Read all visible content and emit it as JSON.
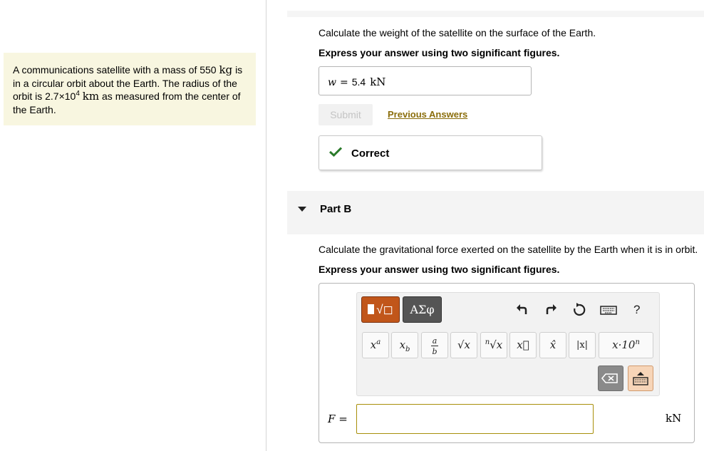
{
  "problem": {
    "text_1": "A communications satellite with a mass of 550",
    "mass_unit": "kg",
    "text_2": "is in a circular orbit about the Earth. The radius of the orbit is 2.7×10",
    "radius_exp": "4",
    "radius_unit": "km",
    "text_3": "as measured from the center of the Earth."
  },
  "part_a": {
    "question": "Calculate the weight of the satellite on the surface of the Earth.",
    "instruction": "Express your answer using two significant figures.",
    "answer_var": "w",
    "answer_eq": "=",
    "answer_value": "5.4",
    "answer_unit": "kN",
    "submit_label": "Submit",
    "previous_answers_label": "Previous Answers",
    "feedback": "Correct"
  },
  "part_b": {
    "title": "Part B",
    "question": "Calculate the gravitational force exerted on the satellite by the Earth when it is in orbit.",
    "instruction": "Express your answer using two significant figures.",
    "toolbar": {
      "template_label": "√◻",
      "greek_label": "ΑΣφ",
      "help_label": "?"
    },
    "math_buttons": [
      "x^a",
      "x_b",
      "a/b",
      "√x",
      "ⁿ√x",
      "x⃗",
      "x̂",
      "|x|",
      "x·10^n"
    ],
    "answer_var": "F",
    "answer_eq": "=",
    "answer_value": "",
    "answer_unit": "kN"
  },
  "colors": {
    "problem_bg": "#f8f6e0",
    "link": "#8a6d0b",
    "correct_check": "#2a7a2a",
    "template_btn": "#c1561a",
    "input_border": "#a88f0a"
  }
}
